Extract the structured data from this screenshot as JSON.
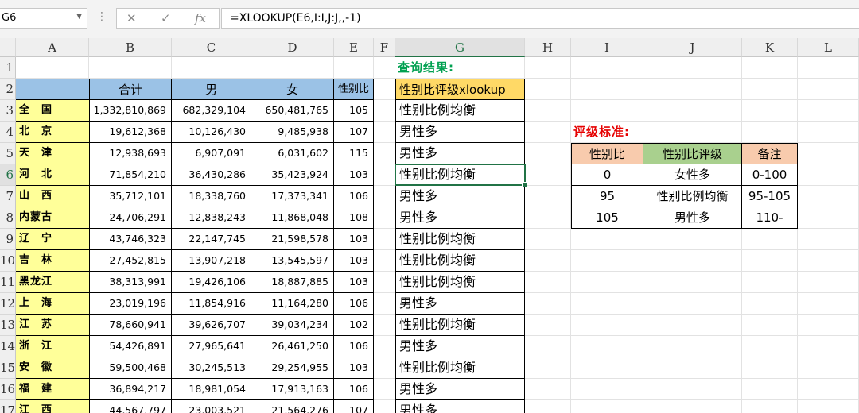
{
  "name_box": "G6",
  "formula_bar": {
    "cancel_icon": "✕",
    "enter_icon": "✓",
    "fx_icon": "fx",
    "formula": "=XLOOKUP(E6,I:I,J:J,,-1)"
  },
  "columns": [
    "A",
    "B",
    "C",
    "D",
    "E",
    "F",
    "G",
    "H",
    "I",
    "J",
    "K",
    "L"
  ],
  "rows": [
    "1",
    "2",
    "3",
    "4",
    "5",
    "6",
    "7",
    "8",
    "9",
    "10",
    "11",
    "12",
    "13",
    "14",
    "15",
    "16",
    "17"
  ],
  "headers": {
    "total": "合计",
    "male": "男",
    "female": "女",
    "ratio": "性别比"
  },
  "provinces": [
    {
      "name": "全　国",
      "total": "1,332,810,869",
      "male": "682,329,104",
      "female": "650,481,765",
      "ratio": "105",
      "result": "性别比例均衡"
    },
    {
      "name": "北　京",
      "total": "19,612,368",
      "male": "10,126,430",
      "female": "9,485,938",
      "ratio": "107",
      "result": "男性多"
    },
    {
      "name": "天　津",
      "total": "12,938,693",
      "male": "6,907,091",
      "female": "6,031,602",
      "ratio": "115",
      "result": "男性多"
    },
    {
      "name": "河　北",
      "total": "71,854,210",
      "male": "36,430,286",
      "female": "35,423,924",
      "ratio": "103",
      "result": "性别比例均衡"
    },
    {
      "name": "山　西",
      "total": "35,712,101",
      "male": "18,338,760",
      "female": "17,373,341",
      "ratio": "106",
      "result": "男性多"
    },
    {
      "name": "内蒙古",
      "total": "24,706,291",
      "male": "12,838,243",
      "female": "11,868,048",
      "ratio": "108",
      "result": "男性多"
    },
    {
      "name": "辽　宁",
      "total": "43,746,323",
      "male": "22,147,745",
      "female": "21,598,578",
      "ratio": "103",
      "result": "性别比例均衡"
    },
    {
      "name": "吉　林",
      "total": "27,452,815",
      "male": "13,907,218",
      "female": "13,545,597",
      "ratio": "103",
      "result": "性别比例均衡"
    },
    {
      "name": "黑龙江",
      "total": "38,313,991",
      "male": "19,426,106",
      "female": "18,887,885",
      "ratio": "103",
      "result": "性别比例均衡"
    },
    {
      "name": "上　海",
      "total": "23,019,196",
      "male": "11,854,916",
      "female": "11,164,280",
      "ratio": "106",
      "result": "男性多"
    },
    {
      "name": "江　苏",
      "total": "78,660,941",
      "male": "39,626,707",
      "female": "39,034,234",
      "ratio": "102",
      "result": "性别比例均衡"
    },
    {
      "name": "浙　江",
      "total": "54,426,891",
      "male": "27,965,641",
      "female": "26,461,250",
      "ratio": "106",
      "result": "男性多"
    },
    {
      "name": "安　徽",
      "total": "59,500,468",
      "male": "30,245,513",
      "female": "29,254,955",
      "ratio": "103",
      "result": "性别比例均衡"
    },
    {
      "name": "福　建",
      "total": "36,894,217",
      "male": "18,981,054",
      "female": "17,913,163",
      "ratio": "106",
      "result": "男性多"
    },
    {
      "name": "江　西",
      "total": "44,567,797",
      "male": "23,003,521",
      "female": "21,564,276",
      "ratio": "107",
      "result": "男性多"
    }
  ],
  "query": {
    "title": "查询结果:",
    "header": "性别比评级xlookup"
  },
  "criteria": {
    "title": "评级标准:",
    "headers": [
      "性别比",
      "性别比评级",
      "备注"
    ],
    "rows": [
      [
        "0",
        "女性多",
        "0-100"
      ],
      [
        "95",
        "性别比例均衡",
        "95-105"
      ],
      [
        "105",
        "男性多",
        "110-"
      ]
    ]
  },
  "colors": {
    "yellow": "#ffff99",
    "blue": "#9bc2e6",
    "gold": "#ffd966",
    "orange": "#f8cbad",
    "green": "#a9d08e",
    "select": "#217346"
  }
}
